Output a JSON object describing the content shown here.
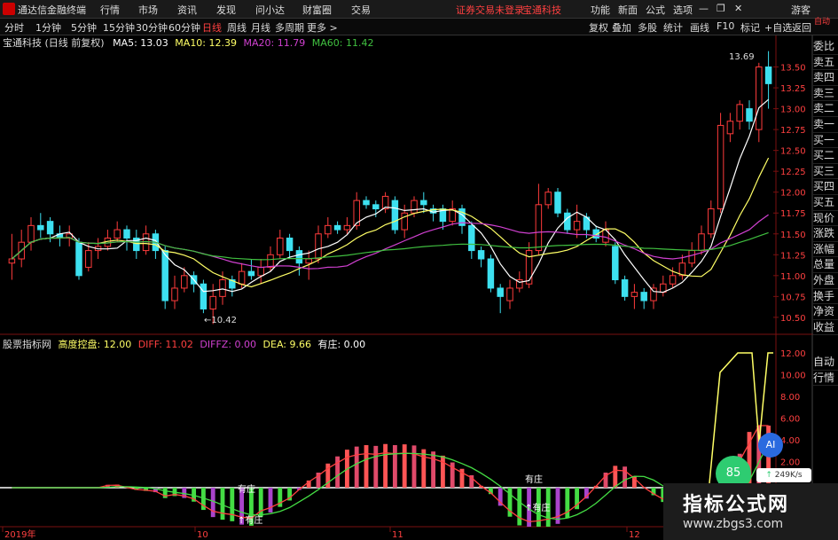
{
  "titlebar": {
    "app_name": "通达信金融终端",
    "menus": [
      "行情",
      "市场",
      "资讯",
      "发现",
      "问小达",
      "财富圈",
      "交易"
    ],
    "alert": "证券交易未登录",
    "stock_tag": "宝通科技",
    "right_menus": [
      "功能",
      "新面",
      "公式",
      "选项"
    ],
    "guest": "游客"
  },
  "toolbar": {
    "periods": [
      "分时",
      "1分钟",
      "5分钟",
      "15分钟",
      "30分钟",
      "60分钟",
      "日线",
      "周线",
      "月线",
      "多周期",
      "更多 >"
    ],
    "active": "日线",
    "right_buttons": [
      "复权",
      "叠加",
      "多股",
      "统计",
      "画线",
      "F10",
      "标记",
      "+自选",
      "返回"
    ]
  },
  "main_info": {
    "stock": "宝通科技 (日线 前复权)",
    "ma5": "MA5: 13.03",
    "ma10": "MA10: 12.39",
    "ma20": "MA20: 11.79",
    "ma60": "MA60: 11.42",
    "high_label": "13.69",
    "low_label": "←10.42"
  },
  "indicator_info": {
    "name": "股票指标网",
    "s1": "高度控盘: 12.00",
    "s2": "DIFF: 11.02",
    "s3": "DIFFZ: 0.00",
    "s4": "DEA: 9.66",
    "s5": "有庄: 0.00",
    "tag1": "有庄",
    "tag2": "↑有庄",
    "tag3": "↑有庄",
    "tag4": "有庄"
  },
  "right_panel": [
    "委比",
    "卖五",
    "卖四",
    "卖三",
    "卖二",
    "卖一",
    "买一",
    "买二",
    "买三",
    "买四",
    "买五",
    "现价",
    "涨跌",
    "涨幅",
    "总量",
    "外盘",
    "换手",
    "净资",
    "收益",
    "自动",
    "行情"
  ],
  "right_top": "自动",
  "price_ticks": [
    "13.50",
    "13.25",
    "13.00",
    "12.75",
    "12.50",
    "12.25",
    "12.00",
    "11.75",
    "11.50",
    "11.25",
    "11.00",
    "10.75",
    "10.50"
  ],
  "ind_ticks": [
    "12.00",
    "10.00",
    "8.00",
    "6.00",
    "4.00",
    "2.00"
  ],
  "x_labels": [
    "2019年",
    "10",
    "11",
    "12"
  ],
  "badges": {
    "ai": "AI",
    "pct": "85",
    "speed": "249K/s"
  },
  "brand": {
    "line1": "指标公式网",
    "line2": "www.zbgs3.com"
  },
  "colors": {
    "up": "#ff3b3b",
    "down": "#3de0f0",
    "ma5": "#ffffff",
    "ma10": "#ffff66",
    "ma20": "#d040d0",
    "ma60": "#40c040"
  },
  "chart_data": {
    "type": "candlestick",
    "ylim": [
      10.35,
      13.75
    ],
    "candles": [
      [
        11.15,
        11.2,
        11.5,
        10.95
      ],
      [
        11.2,
        11.4,
        11.55,
        11.1
      ],
      [
        11.4,
        11.6,
        11.7,
        11.3
      ],
      [
        11.6,
        11.55,
        11.75,
        11.45
      ],
      [
        11.65,
        11.5,
        11.7,
        11.4
      ],
      [
        11.5,
        11.45,
        11.6,
        11.35
      ],
      [
        11.45,
        11.5,
        11.6,
        11.35
      ],
      [
        11.4,
        11.0,
        11.45,
        10.95
      ],
      [
        11.1,
        11.3,
        11.4,
        11.05
      ],
      [
        11.3,
        11.35,
        11.45,
        11.2
      ],
      [
        11.35,
        11.45,
        11.55,
        11.3
      ],
      [
        11.45,
        11.55,
        11.65,
        11.4
      ],
      [
        11.55,
        11.45,
        11.6,
        11.3
      ],
      [
        11.45,
        11.3,
        11.55,
        11.2
      ],
      [
        11.3,
        11.5,
        11.6,
        11.25
      ],
      [
        11.5,
        11.3,
        11.55,
        11.2
      ],
      [
        11.3,
        10.7,
        11.35,
        10.6
      ],
      [
        10.7,
        10.85,
        11.0,
        10.6
      ],
      [
        10.85,
        11.0,
        11.1,
        10.8
      ],
      [
        11.0,
        10.9,
        11.05,
        10.8
      ],
      [
        10.9,
        10.6,
        10.95,
        10.55
      ],
      [
        10.6,
        10.75,
        10.9,
        10.42
      ],
      [
        10.75,
        10.95,
        11.05,
        10.65
      ],
      [
        10.95,
        10.85,
        11.0,
        10.75
      ],
      [
        10.9,
        11.05,
        11.15,
        10.85
      ],
      [
        11.05,
        11.0,
        11.2,
        10.95
      ],
      [
        11.0,
        11.1,
        11.2,
        10.9
      ],
      [
        11.1,
        11.25,
        11.35,
        11.05
      ],
      [
        11.25,
        11.45,
        11.55,
        11.2
      ],
      [
        11.45,
        11.3,
        11.5,
        11.2
      ],
      [
        11.3,
        11.15,
        11.35,
        11.0
      ],
      [
        11.15,
        11.2,
        11.3,
        10.95
      ],
      [
        11.2,
        11.5,
        11.6,
        11.15
      ],
      [
        11.5,
        11.6,
        11.7,
        11.45
      ],
      [
        11.6,
        11.55,
        11.65,
        11.5
      ],
      [
        11.55,
        11.6,
        11.7,
        11.5
      ],
      [
        11.6,
        11.9,
        12.0,
        11.55
      ],
      [
        11.9,
        11.85,
        11.95,
        11.8
      ],
      [
        11.85,
        11.8,
        11.9,
        11.7
      ],
      [
        11.8,
        11.95,
        12.0,
        11.75
      ],
      [
        11.9,
        11.55,
        11.95,
        11.5
      ],
      [
        11.55,
        11.75,
        11.85,
        11.45
      ],
      [
        11.75,
        11.9,
        11.95,
        11.7
      ],
      [
        11.9,
        11.85,
        12.0,
        11.75
      ],
      [
        11.8,
        11.75,
        11.85,
        11.65
      ],
      [
        11.8,
        11.65,
        11.85,
        11.55
      ],
      [
        11.65,
        11.8,
        11.9,
        11.6
      ],
      [
        11.8,
        11.6,
        11.85,
        11.5
      ],
      [
        11.6,
        11.3,
        11.65,
        11.2
      ],
      [
        11.3,
        11.2,
        11.35,
        11.1
      ],
      [
        11.2,
        10.85,
        11.25,
        10.8
      ],
      [
        10.85,
        10.75,
        10.9,
        10.55
      ],
      [
        10.7,
        10.85,
        10.95,
        10.6
      ],
      [
        10.85,
        10.95,
        11.05,
        10.8
      ],
      [
        10.9,
        11.3,
        11.4,
        10.85
      ],
      [
        11.3,
        11.85,
        12.1,
        11.25
      ],
      [
        11.85,
        12.0,
        12.05,
        11.8
      ],
      [
        12.0,
        11.75,
        12.05,
        11.7
      ],
      [
        11.75,
        11.55,
        11.8,
        11.5
      ],
      [
        11.55,
        11.65,
        11.85,
        11.45
      ],
      [
        11.7,
        11.55,
        11.75,
        11.45
      ],
      [
        11.55,
        11.45,
        11.6,
        11.4
      ],
      [
        11.4,
        11.55,
        11.65,
        11.35
      ],
      [
        11.35,
        10.95,
        11.4,
        10.9
      ],
      [
        10.95,
        10.75,
        11.0,
        10.7
      ],
      [
        10.75,
        10.8,
        10.9,
        10.6
      ],
      [
        10.8,
        10.7,
        10.85,
        10.6
      ],
      [
        10.7,
        10.85,
        10.9,
        10.6
      ],
      [
        10.8,
        10.9,
        11.0,
        10.75
      ],
      [
        10.9,
        11.0,
        11.1,
        10.85
      ],
      [
        11.0,
        11.15,
        11.25,
        10.95
      ],
      [
        11.15,
        11.3,
        11.4,
        11.1
      ],
      [
        11.3,
        11.5,
        11.6,
        11.25
      ],
      [
        11.5,
        11.8,
        11.9,
        11.45
      ],
      [
        11.8,
        12.8,
        12.95,
        11.75
      ],
      [
        12.7,
        12.85,
        12.95,
        12.6
      ],
      [
        12.85,
        13.05,
        13.1,
        12.75
      ],
      [
        13.0,
        12.85,
        13.1,
        12.75
      ],
      [
        12.75,
        13.5,
        13.55,
        12.6
      ],
      [
        13.5,
        13.3,
        13.69,
        13.0
      ]
    ]
  }
}
